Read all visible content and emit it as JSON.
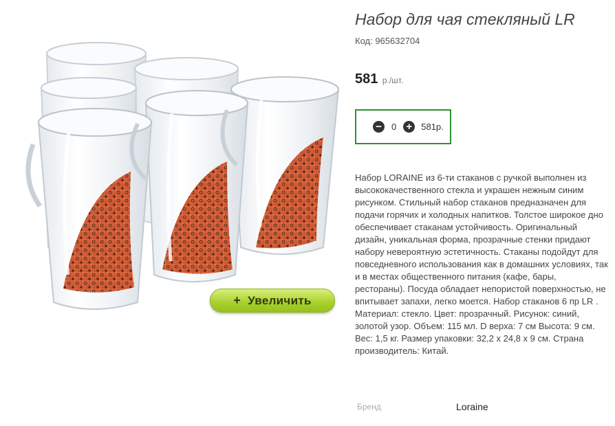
{
  "product": {
    "title": "Набор для чая стекляный LR",
    "sku": "Код: 965632704",
    "price": "581",
    "price_unit": "р./шт.",
    "quantity": "0",
    "sum": "581р.",
    "description": "Набор LORAINE из 6-ти стаканов с ручкой выполнен из высококачественного стекла и украшен нежным синим рисунком. Стильный набор стаканов предназначен для подачи горячих и холодных напитков. Толстое широкое дно обеспечивает стаканам устойчивость. Оригинальный дизайн, уникальная форма, прозрачные стенки придают набору невероятную эстетичность. Стаканы подойдут для повседневного использования как в домашних условиях, так и в местах общественного питания (кафе, бары, рестораны). Посуда обладает непористой поверхностью, не впитывает запахи, легко моется. Набор стаканов 6 пр LR . Материал: стекло. Цвет: прозрачный. Рисунок: синий, золотой узор. Объем: 115 мл. D верха: 7 см Высота: 9 см. Вес: 1,5 кг. Размер упаковки: 32,2 х 24,8 х 9 см. Страна производитель: Китай.",
    "brand_label": "Бренд",
    "brand_value": "Loraine"
  },
  "image": {
    "zoom_label": "Увеличить",
    "zoom_icon": "plus-icon",
    "glass_color": "#f4f6f8",
    "pattern_color": "#d8522a"
  },
  "controls": {
    "minus_icon": "minus-circle-icon",
    "plus_icon": "plus-circle-icon",
    "box_border": "#2f8f2f"
  }
}
